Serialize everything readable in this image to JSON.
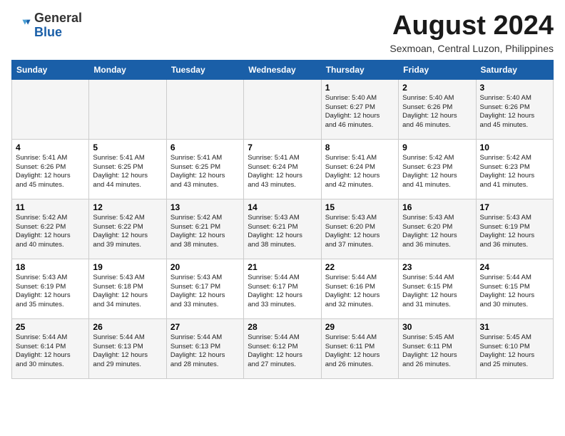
{
  "logo": {
    "general": "General",
    "blue": "Blue"
  },
  "header": {
    "title": "August 2024",
    "subtitle": "Sexmoan, Central Luzon, Philippines"
  },
  "weekdays": [
    "Sunday",
    "Monday",
    "Tuesday",
    "Wednesday",
    "Thursday",
    "Friday",
    "Saturday"
  ],
  "weeks": [
    [
      {
        "day": "",
        "info": ""
      },
      {
        "day": "",
        "info": ""
      },
      {
        "day": "",
        "info": ""
      },
      {
        "day": "",
        "info": ""
      },
      {
        "day": "1",
        "info": "Sunrise: 5:40 AM\nSunset: 6:27 PM\nDaylight: 12 hours\nand 46 minutes."
      },
      {
        "day": "2",
        "info": "Sunrise: 5:40 AM\nSunset: 6:26 PM\nDaylight: 12 hours\nand 46 minutes."
      },
      {
        "day": "3",
        "info": "Sunrise: 5:40 AM\nSunset: 6:26 PM\nDaylight: 12 hours\nand 45 minutes."
      }
    ],
    [
      {
        "day": "4",
        "info": "Sunrise: 5:41 AM\nSunset: 6:26 PM\nDaylight: 12 hours\nand 45 minutes."
      },
      {
        "day": "5",
        "info": "Sunrise: 5:41 AM\nSunset: 6:25 PM\nDaylight: 12 hours\nand 44 minutes."
      },
      {
        "day": "6",
        "info": "Sunrise: 5:41 AM\nSunset: 6:25 PM\nDaylight: 12 hours\nand 43 minutes."
      },
      {
        "day": "7",
        "info": "Sunrise: 5:41 AM\nSunset: 6:24 PM\nDaylight: 12 hours\nand 43 minutes."
      },
      {
        "day": "8",
        "info": "Sunrise: 5:41 AM\nSunset: 6:24 PM\nDaylight: 12 hours\nand 42 minutes."
      },
      {
        "day": "9",
        "info": "Sunrise: 5:42 AM\nSunset: 6:23 PM\nDaylight: 12 hours\nand 41 minutes."
      },
      {
        "day": "10",
        "info": "Sunrise: 5:42 AM\nSunset: 6:23 PM\nDaylight: 12 hours\nand 41 minutes."
      }
    ],
    [
      {
        "day": "11",
        "info": "Sunrise: 5:42 AM\nSunset: 6:22 PM\nDaylight: 12 hours\nand 40 minutes."
      },
      {
        "day": "12",
        "info": "Sunrise: 5:42 AM\nSunset: 6:22 PM\nDaylight: 12 hours\nand 39 minutes."
      },
      {
        "day": "13",
        "info": "Sunrise: 5:42 AM\nSunset: 6:21 PM\nDaylight: 12 hours\nand 38 minutes."
      },
      {
        "day": "14",
        "info": "Sunrise: 5:43 AM\nSunset: 6:21 PM\nDaylight: 12 hours\nand 38 minutes."
      },
      {
        "day": "15",
        "info": "Sunrise: 5:43 AM\nSunset: 6:20 PM\nDaylight: 12 hours\nand 37 minutes."
      },
      {
        "day": "16",
        "info": "Sunrise: 5:43 AM\nSunset: 6:20 PM\nDaylight: 12 hours\nand 36 minutes."
      },
      {
        "day": "17",
        "info": "Sunrise: 5:43 AM\nSunset: 6:19 PM\nDaylight: 12 hours\nand 36 minutes."
      }
    ],
    [
      {
        "day": "18",
        "info": "Sunrise: 5:43 AM\nSunset: 6:19 PM\nDaylight: 12 hours\nand 35 minutes."
      },
      {
        "day": "19",
        "info": "Sunrise: 5:43 AM\nSunset: 6:18 PM\nDaylight: 12 hours\nand 34 minutes."
      },
      {
        "day": "20",
        "info": "Sunrise: 5:43 AM\nSunset: 6:17 PM\nDaylight: 12 hours\nand 33 minutes."
      },
      {
        "day": "21",
        "info": "Sunrise: 5:44 AM\nSunset: 6:17 PM\nDaylight: 12 hours\nand 33 minutes."
      },
      {
        "day": "22",
        "info": "Sunrise: 5:44 AM\nSunset: 6:16 PM\nDaylight: 12 hours\nand 32 minutes."
      },
      {
        "day": "23",
        "info": "Sunrise: 5:44 AM\nSunset: 6:15 PM\nDaylight: 12 hours\nand 31 minutes."
      },
      {
        "day": "24",
        "info": "Sunrise: 5:44 AM\nSunset: 6:15 PM\nDaylight: 12 hours\nand 30 minutes."
      }
    ],
    [
      {
        "day": "25",
        "info": "Sunrise: 5:44 AM\nSunset: 6:14 PM\nDaylight: 12 hours\nand 30 minutes."
      },
      {
        "day": "26",
        "info": "Sunrise: 5:44 AM\nSunset: 6:13 PM\nDaylight: 12 hours\nand 29 minutes."
      },
      {
        "day": "27",
        "info": "Sunrise: 5:44 AM\nSunset: 6:13 PM\nDaylight: 12 hours\nand 28 minutes."
      },
      {
        "day": "28",
        "info": "Sunrise: 5:44 AM\nSunset: 6:12 PM\nDaylight: 12 hours\nand 27 minutes."
      },
      {
        "day": "29",
        "info": "Sunrise: 5:44 AM\nSunset: 6:11 PM\nDaylight: 12 hours\nand 26 minutes."
      },
      {
        "day": "30",
        "info": "Sunrise: 5:45 AM\nSunset: 6:11 PM\nDaylight: 12 hours\nand 26 minutes."
      },
      {
        "day": "31",
        "info": "Sunrise: 5:45 AM\nSunset: 6:10 PM\nDaylight: 12 hours\nand 25 minutes."
      }
    ]
  ]
}
